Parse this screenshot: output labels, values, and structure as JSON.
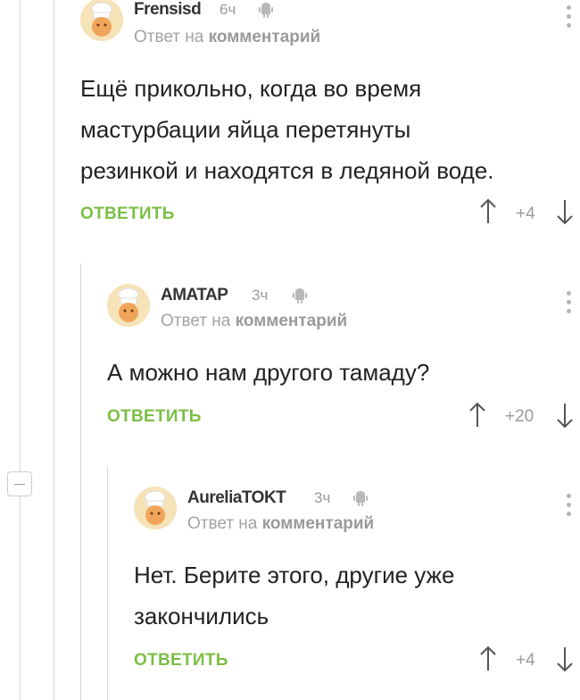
{
  "ui": {
    "reply_to_prefix": "Ответ на",
    "reply_to_target": "комментарий",
    "reply_button": "ОТВЕТИТЬ"
  },
  "comments": [
    {
      "username": "Frensisd",
      "time": "6ч",
      "text_lines": [
        "Ещё прикольно, когда во время",
        "мастурбации яйца перетянуты",
        "резинкой и находятся в ледяной воде."
      ],
      "rating": "+4",
      "icons": [
        "avatar",
        "android-icon",
        "more-icon",
        "arrow-up-icon",
        "arrow-down-icon"
      ]
    },
    {
      "username": "AMATAP",
      "time": "3ч",
      "text_lines": [
        "А можно нам другого тамаду?"
      ],
      "rating": "+20"
    },
    {
      "username": "AureliaTOKT",
      "time": "3ч",
      "text_lines": [
        "Нет. Берите этого, другие уже",
        "закончились"
      ],
      "rating": "+4"
    }
  ],
  "colors": {
    "accent": "#7cbf45",
    "muted": "#9a9a9a",
    "text": "#222222"
  }
}
